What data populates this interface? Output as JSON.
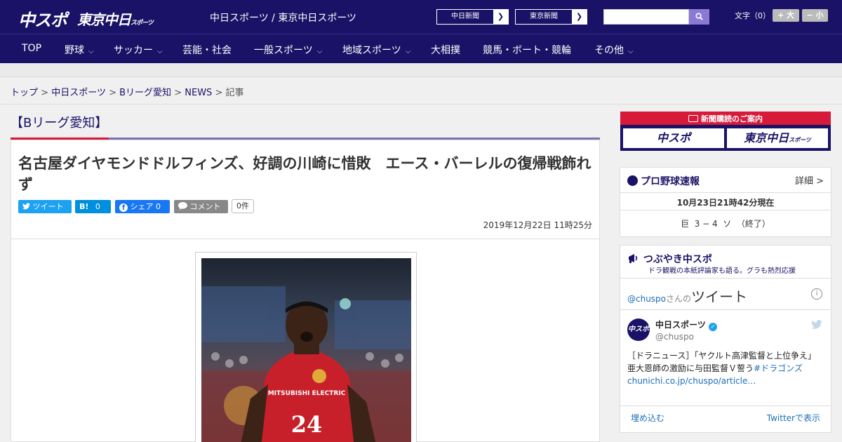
{
  "header": {
    "logo_main": "中スポ",
    "logo_sub": "東京中日",
    "logo_sub_small": "スポーツ",
    "site_names": "中日スポーツ / 東京中日スポーツ",
    "paper_buttons": [
      "中日新聞",
      "東京新聞"
    ],
    "font_size_label": "文字（0）",
    "font_plus": "+ 大",
    "font_minus": "− 小"
  },
  "nav": {
    "items": [
      {
        "label": "TOP",
        "has_menu": false
      },
      {
        "label": "野球",
        "has_menu": true
      },
      {
        "label": "サッカー",
        "has_menu": true
      },
      {
        "label": "芸能・社会",
        "has_menu": false
      },
      {
        "label": "一般スポーツ",
        "has_menu": true
      },
      {
        "label": "地域スポーツ",
        "has_menu": true
      },
      {
        "label": "大相撲",
        "has_menu": false
      },
      {
        "label": "競馬・ボート・競輪",
        "has_menu": false
      },
      {
        "label": "その他",
        "has_menu": true
      }
    ]
  },
  "breadcrumb": {
    "items": [
      "トップ",
      "中日スポーツ",
      "Bリーグ愛知",
      "NEWS"
    ],
    "current": "記事",
    "separator": ">"
  },
  "article": {
    "section": "【Bリーグ愛知】",
    "headline": "名古屋ダイヤモンドドルフィンズ、好調の川崎に惜敗　エース・バーレルの復帰戦飾れず",
    "share": {
      "tweet": "ツイート",
      "hatena_icon": "B!",
      "hatena_count": "0",
      "facebook": "シェア",
      "facebook_count": "0",
      "comment": "コメント",
      "comment_count": "0件"
    },
    "date": "2019年12月22日 11時25分",
    "photo_jersey_brand": "MITSUBISHI ELECTRIC",
    "photo_jersey_number": "24"
  },
  "sidebar": {
    "ad_title": "新聞購読のご案内",
    "ad_boxes": [
      "中スポ",
      "東京中日"
    ],
    "ad_box_small": "スポーツ",
    "baseball": {
      "title": "プロ野球速報",
      "detail_link": "詳細 >",
      "timestamp": "10月23日21時42分現在",
      "score_line": "巨  3 − 4  ソ  （終了）"
    },
    "tsubuyaki": {
      "title": "つぶやき中スポ",
      "subtitle": "ドラ観戦の本紙評論家も語る。グラも熱烈応援",
      "tweets_by_prefix": "@chuspo",
      "tweets_by_mid": "さんの",
      "tweets_by_big": "ツイート",
      "account_name": "中日スポーツ",
      "account_handle": "@chuspo",
      "avatar_text": "中スポ",
      "tweet_line1": "［ドラニュース］「ヤクルト高津監督と上位争え」",
      "tweet_line2": "亜大恩師の激励に与田監督Ｖ誓う",
      "tweet_hashtag": "#ドラゴンズ",
      "tweet_link": "chunichi.co.jp/chuspo/article…",
      "embed_label": "埋め込む",
      "view_on_twitter": "Twitterで表示"
    }
  },
  "colors": {
    "brand_navy": "#1a1266",
    "accent_red": "#d7193a",
    "twitter_blue": "#1da1f2",
    "hatena_blue": "#008fde",
    "facebook_blue": "#1877f2"
  },
  "icons": {
    "search": "search-icon",
    "twitter": "twitter-bird-icon",
    "facebook": "facebook-icon",
    "comment": "speech-bubble-icon",
    "baseball": "baseball-icon",
    "megaphone": "megaphone-icon",
    "info": "info-icon",
    "verified": "verified-badge-icon",
    "newspaper": "newspaper-icon"
  }
}
